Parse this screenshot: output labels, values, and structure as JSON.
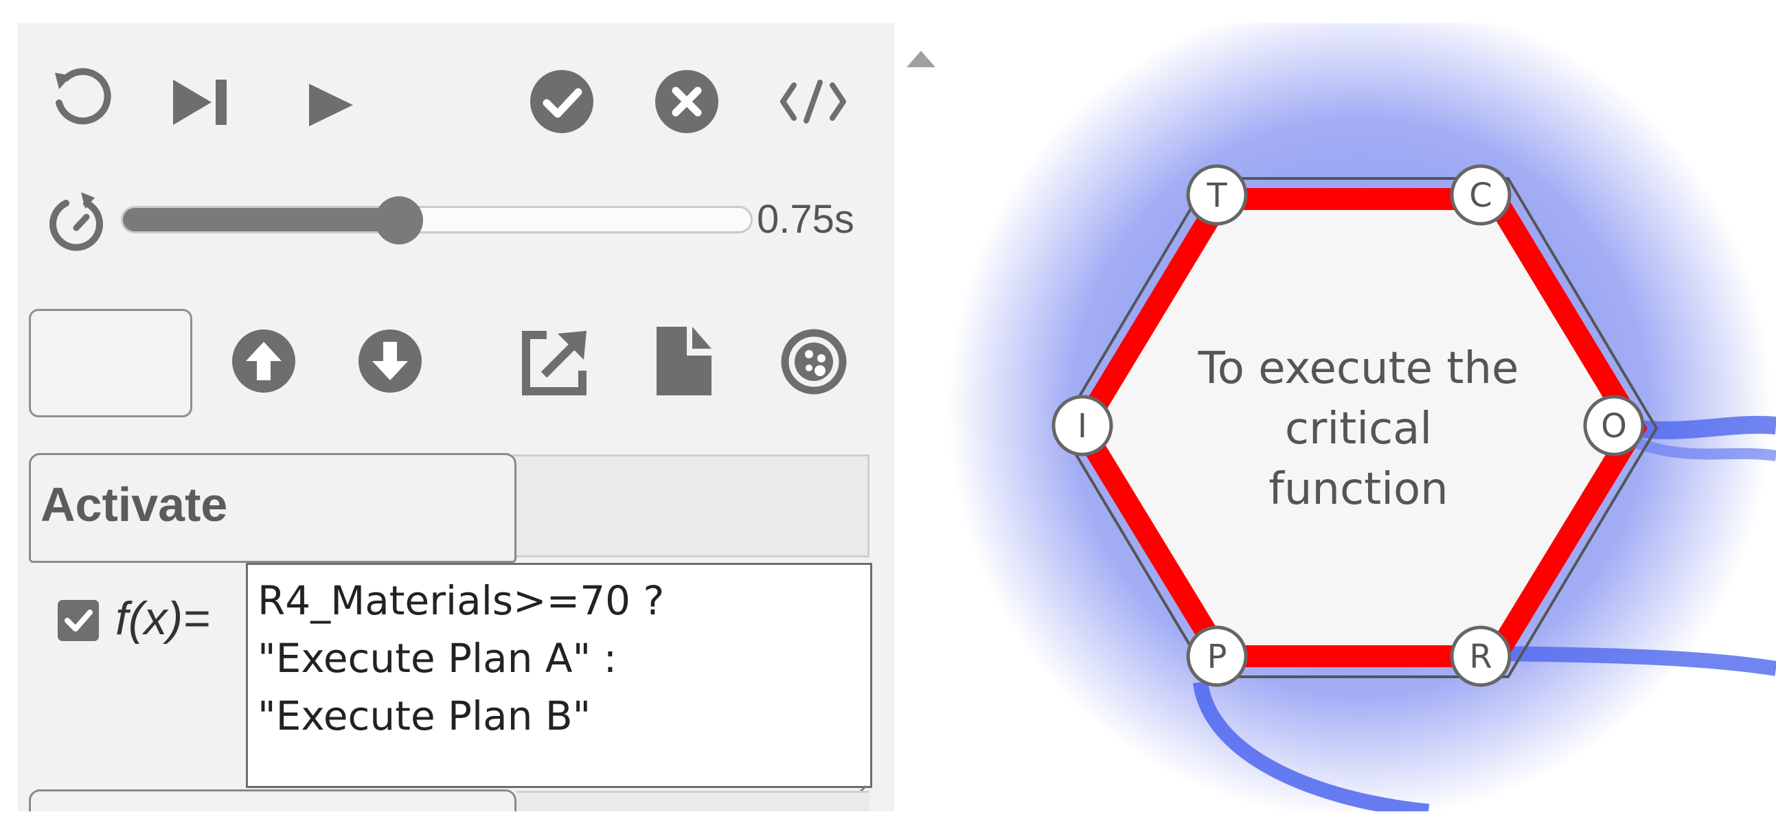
{
  "toolbar": {
    "icons": [
      "reset-icon",
      "step-forward-icon",
      "play-icon",
      "check-circle-icon",
      "cancel-circle-icon",
      "code-icon"
    ]
  },
  "speed": {
    "icon": "speed-timer-icon",
    "value_fraction": 0.44,
    "value_label": "0.75s"
  },
  "file_toolbar": {
    "text_box_value": "",
    "icons": [
      "upload-arrow-icon",
      "download-arrow-icon",
      "export-icon",
      "file-icon",
      "palette-icon"
    ]
  },
  "tabs": {
    "active_label": "Activate",
    "other_label": ""
  },
  "function": {
    "checkbox_checked": true,
    "label": "f(x)=",
    "expression_lines": [
      "R4_Materials>=70 ?",
      "\"Execute Plan A\" :",
      "\"Execute Plan B\""
    ]
  },
  "graph": {
    "node": {
      "text_lines": [
        "To execute the",
        "critical",
        "function"
      ],
      "border_color": "#ff0000",
      "glow_color": "#6677ee"
    },
    "ports": {
      "top_left": "T",
      "top_right": "C",
      "left": "I",
      "right": "O",
      "bottom_left": "P",
      "bottom_right": "R"
    }
  }
}
